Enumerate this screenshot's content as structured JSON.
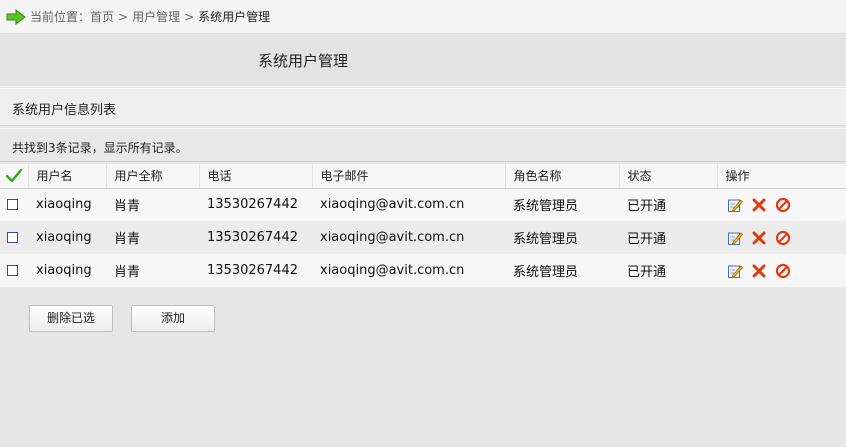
{
  "breadcrumb": {
    "prefix": "当前位置：首页",
    "sep1": ">",
    "item1": "用户管理",
    "sep2": ">",
    "current": "系统用户管理"
  },
  "page": {
    "title": "系统用户管理"
  },
  "section": {
    "title": "系统用户信息列表"
  },
  "summary": {
    "text": "共找到3条记录，显示所有记录。"
  },
  "table": {
    "headers": [
      "用户名",
      "用户全称",
      "电话",
      "电子邮件",
      "角色名称",
      "状态",
      "操作"
    ],
    "rows": [
      {
        "username": "xiaoqing",
        "fullname": "肖青",
        "phone": "13530267442",
        "email": "xiaoqing@avit.com.cn",
        "role": "系统管理员",
        "status": "已开通"
      },
      {
        "username": "xiaoqing",
        "fullname": "肖青",
        "phone": "13530267442",
        "email": "xiaoqing@avit.com.cn",
        "role": "系统管理员",
        "status": "已开通"
      },
      {
        "username": "xiaoqing",
        "fullname": "肖青",
        "phone": "13530267442",
        "email": "xiaoqing@avit.com.cn",
        "role": "系统管理员",
        "status": "已开通"
      }
    ]
  },
  "buttons": {
    "delete_selected": "删除已选",
    "add": "添加"
  },
  "icons": {
    "breadcrumb": "arrow-right-icon",
    "select_all": "checkmark-icon",
    "edit": "edit-icon",
    "delete": "delete-x-icon",
    "disable": "disable-icon"
  },
  "colors": {
    "arrow": "#45b516",
    "check": "#3aa31c",
    "delete": "#e03a14",
    "disable": "#e03a14"
  }
}
